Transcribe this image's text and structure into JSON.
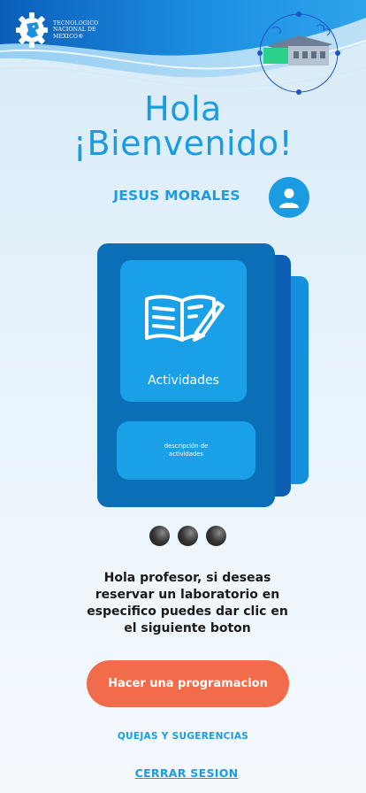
{
  "header": {
    "logo_text": "TECNOLOGICO\nNACIONAL DE MEXICO®",
    "logo_icon": "tecnm-gear-logo-icon",
    "illustration_icon": "laboratory-building-illustration"
  },
  "greeting": {
    "line1": "Hola",
    "line2": "¡Bienvenido!"
  },
  "user": {
    "name": "JESUS MORALES",
    "avatar_icon": "user-avatar-icon"
  },
  "carousel": {
    "card": {
      "icon": "open-book-pencil-icon",
      "label": "Actividades",
      "description": "descripción de actividades"
    },
    "dots": 3
  },
  "message": "Hola profesor, si deseas reservar un laboratorio en especifico puedes dar clic en el siguiente boton",
  "actions": {
    "schedule_button": "Hacer una programacion",
    "feedback_link": "QUEJAS Y SUGERENCIAS",
    "logout_link": "CERRAR SESION"
  },
  "colors": {
    "primary_blue": "#1b9ce2",
    "card_blue": "#0a6fb6",
    "accent_orange": "#f26b4a",
    "text_dark": "#1a1a1a"
  }
}
